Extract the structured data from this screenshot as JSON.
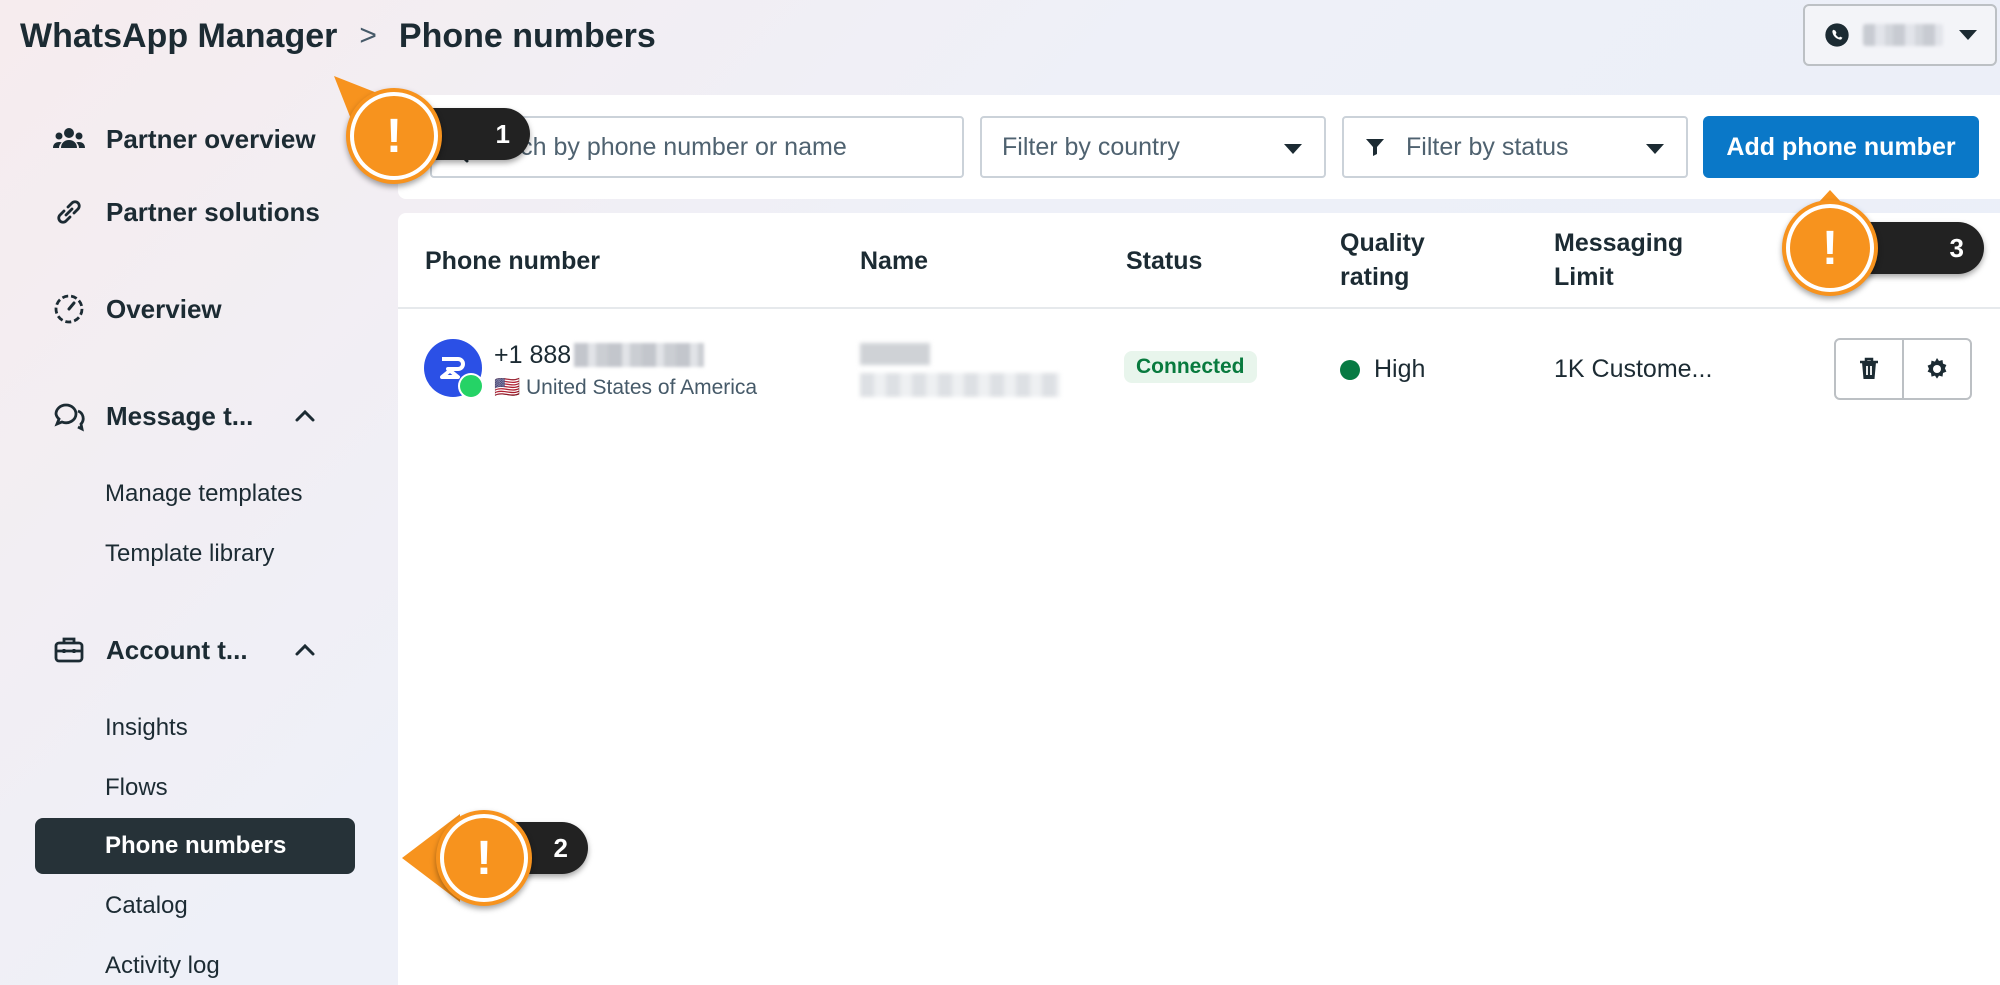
{
  "header": {
    "app_title": "WhatsApp Manager",
    "separator": ">",
    "page_title": "Phone numbers"
  },
  "sidebar": {
    "items": [
      {
        "label": "Partner overview",
        "icon": "people-icon"
      },
      {
        "label": "Partner solutions",
        "icon": "link-icon"
      },
      {
        "label": "Overview",
        "icon": "gauge-icon"
      },
      {
        "label": "Message t...",
        "icon": "chat-icon",
        "expanded": true
      },
      {
        "label": "Account t...",
        "icon": "toolbox-icon",
        "expanded": true
      }
    ],
    "message_sub": [
      "Manage templates",
      "Template library"
    ],
    "account_sub": [
      "Insights",
      "Flows",
      "Phone numbers",
      "Catalog",
      "Activity log"
    ],
    "active": "Phone numbers"
  },
  "toolbar": {
    "search_placeholder": "Search by phone number or name",
    "search_visible": "earch by phone number or name",
    "country_filter": "Filter by country",
    "status_filter": "Filter by status",
    "add_button": "Add phone number"
  },
  "table": {
    "columns": [
      "Phone number",
      "Name",
      "Status",
      "Quality\nrating",
      "Messaging\nLimit"
    ],
    "rows": [
      {
        "phone_prefix": "+1 888",
        "country": "🇺🇸 United States of America",
        "status": "Connected",
        "quality": "High",
        "messaging_limit": "1K Custome..."
      }
    ]
  },
  "callouts": [
    "1",
    "2",
    "3"
  ],
  "colors": {
    "accent": "#0a78c8",
    "active_nav": "#263238",
    "connected_bg": "#e8f5ec",
    "connected_text": "#087a3e",
    "quality_high": "#077a43",
    "callout_orange": "#f7931e"
  }
}
